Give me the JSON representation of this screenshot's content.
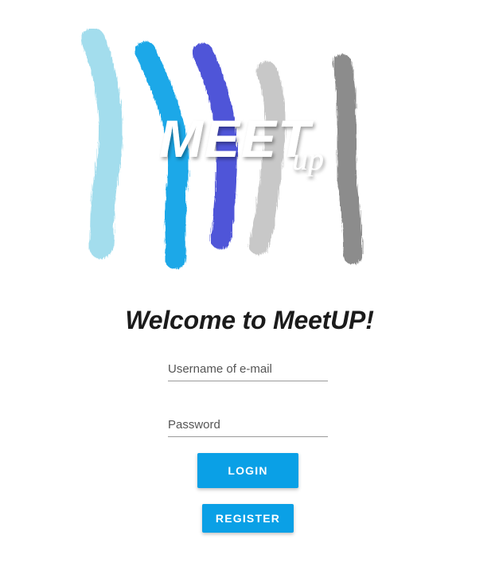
{
  "logo": {
    "wordmark_main": "MEET",
    "wordmark_sub": "up",
    "stroke_colors": [
      "#9fdcec",
      "#1ea9e6",
      "#4d55d6",
      "#c6c6c6",
      "#8a8a8a"
    ]
  },
  "welcome": {
    "title": "Welcome to MeetUP!"
  },
  "form": {
    "username_placeholder": "Username of e-mail",
    "username_value": "",
    "password_placeholder": "Password",
    "password_value": "",
    "login_label": "LOGIN",
    "register_label": "REGISTER"
  },
  "colors": {
    "accent": "#0aa0e6",
    "text": "#1b1b1b"
  }
}
